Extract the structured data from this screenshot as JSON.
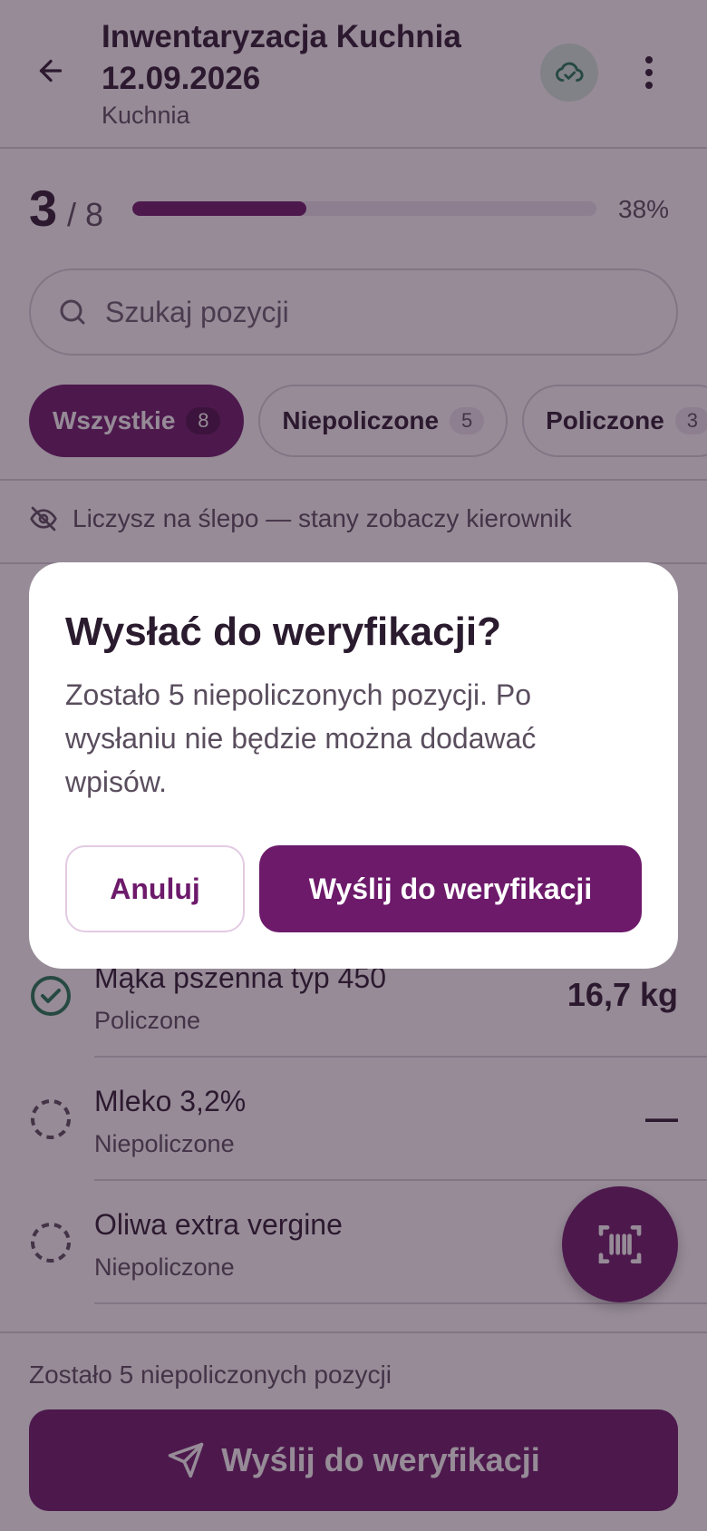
{
  "header": {
    "title": "Inwentaryzacja Kuchnia 12.09.2026",
    "subtitle": "Kuchnia",
    "icons": {
      "back": "arrow-left-icon",
      "sync": "cloud-check-icon",
      "more": "more-vertical-icon"
    }
  },
  "progress": {
    "counted": "3",
    "total": "/ 8",
    "percent_label": "38%",
    "fraction": 0.375
  },
  "search": {
    "placeholder": "Szukaj pozycji"
  },
  "filters": [
    {
      "label": "Wszystkie",
      "count": "8",
      "active": true
    },
    {
      "label": "Niepoliczone",
      "count": "5",
      "active": false
    },
    {
      "label": "Policzone",
      "count": "3",
      "active": false
    }
  ],
  "blind_notice": "Liczysz na ślepo — stany zobaczy kierownik",
  "items": [
    {
      "name": "Mąka pszenna typ 450",
      "state": "Policzone",
      "qty": "16,7 kg",
      "counted": true
    },
    {
      "name": "Mleko 3,2%",
      "state": "Niepoliczone",
      "qty": "—",
      "counted": false
    },
    {
      "name": "Oliwa extra vergine",
      "state": "Niepoliczone",
      "qty": "",
      "counted": false
    }
  ],
  "footer": {
    "remaining": "Zostało 5 niepoliczonych pozycji",
    "submit_label": "Wyślij do weryfikacji"
  },
  "dialog": {
    "title": "Wysłać do weryfikacji?",
    "body": "Zostało 5 niepoliczonych pozycji. Po wysłaniu nie będzie można dodawać wpisów.",
    "cancel_label": "Anuluj",
    "confirm_label": "Wyślij do weryfikacji"
  },
  "colors": {
    "accent": "#6d1a6b",
    "success": "#1f7a52",
    "scrim": "rgba(46,24,48,0.5)"
  }
}
